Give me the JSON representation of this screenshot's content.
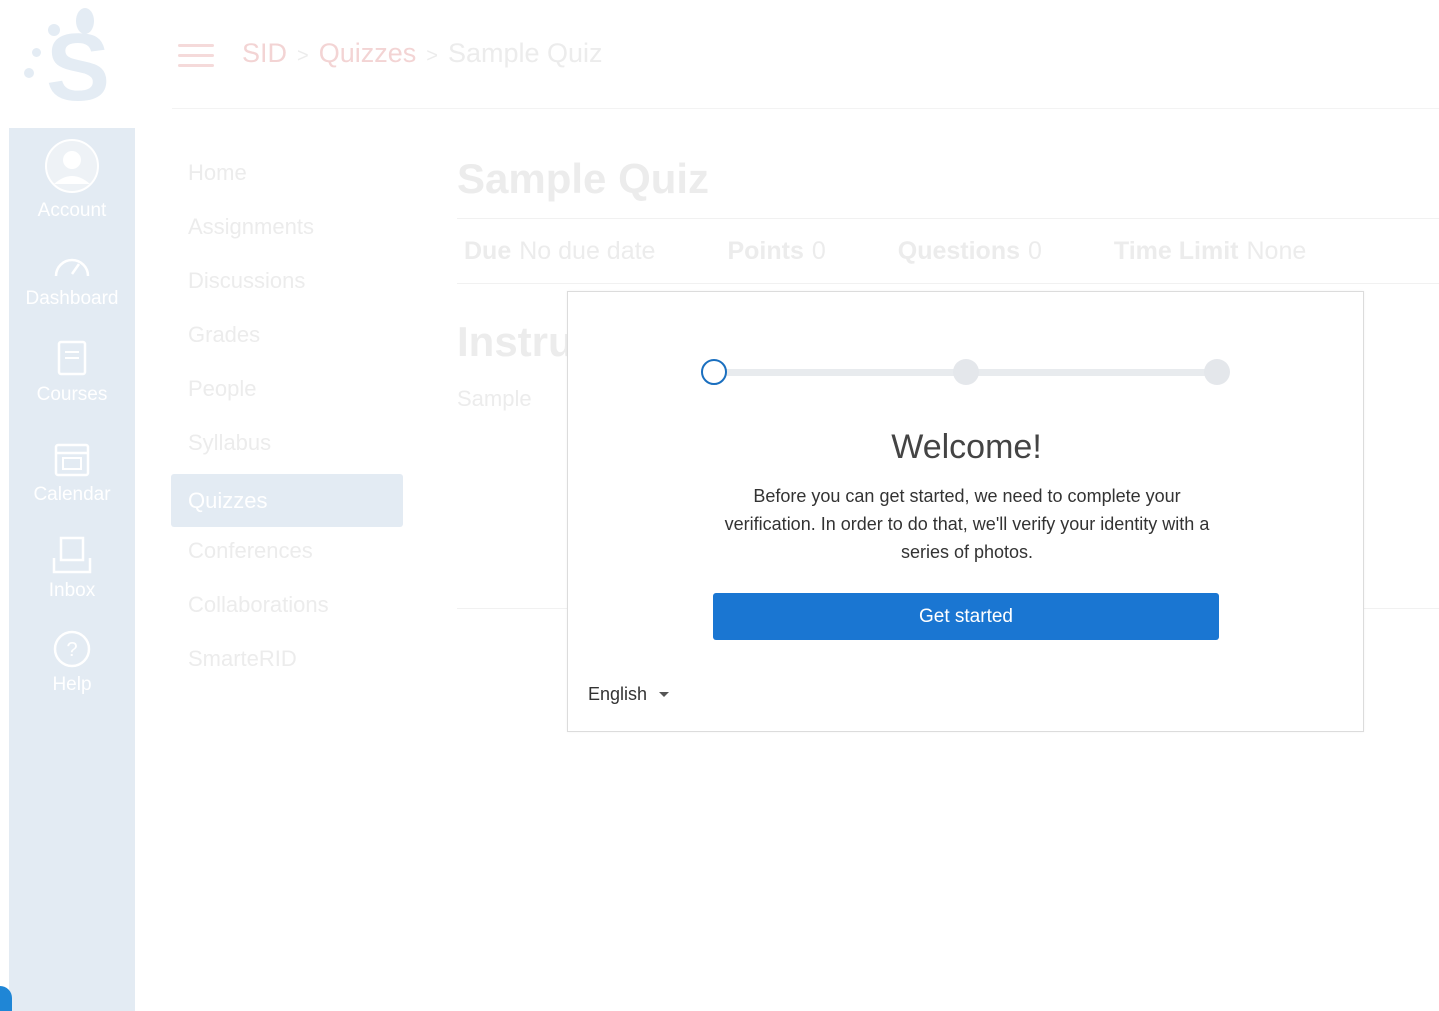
{
  "breadcrumb": {
    "items": [
      "SID",
      "Quizzes"
    ],
    "current": "Sample Quiz"
  },
  "global_nav": {
    "items": [
      {
        "label": "Account",
        "icon": "avatar-icon"
      },
      {
        "label": "Dashboard",
        "icon": "dashboard-icon"
      },
      {
        "label": "Courses",
        "icon": "courses-icon"
      },
      {
        "label": "Calendar",
        "icon": "calendar-icon"
      },
      {
        "label": "Inbox",
        "icon": "inbox-icon"
      },
      {
        "label": "Help",
        "icon": "help-icon"
      }
    ]
  },
  "course_nav": {
    "items": [
      "Home",
      "Assignments",
      "Discussions",
      "Grades",
      "People",
      "Syllabus",
      "Quizzes",
      "Conferences",
      "Collaborations",
      "SmarteRID"
    ],
    "active": "Quizzes"
  },
  "quiz": {
    "title": "Sample Quiz",
    "details": [
      {
        "label": "Due",
        "value": "No due date"
      },
      {
        "label": "Points",
        "value": "0"
      },
      {
        "label": "Questions",
        "value": "0"
      },
      {
        "label": "Time Limit",
        "value": "None"
      }
    ],
    "instructions_heading": "Instru",
    "instructions_text": "Sample"
  },
  "modal": {
    "title": "Welcome!",
    "body": "Before you can get started, we need to complete your verification. In order to do that, we'll verify your identity with a series of photos.",
    "button_label": "Get started",
    "language": "English",
    "steps_total": 3,
    "current_step": 1
  },
  "colors": {
    "primary": "#1a76d2",
    "nav_bg": "#e3ebf3",
    "step_active_border": "#1a6fbf"
  }
}
